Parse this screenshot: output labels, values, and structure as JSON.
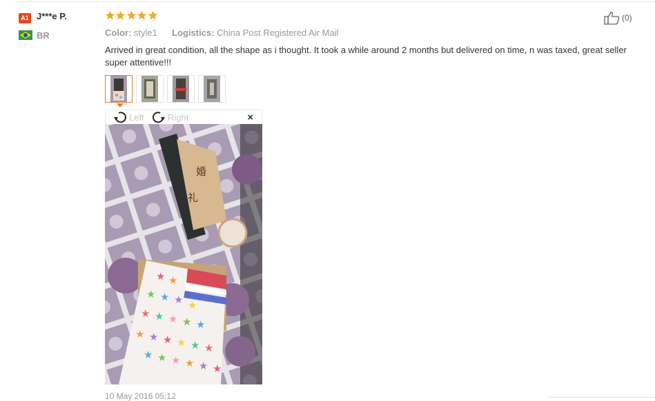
{
  "reviewer": {
    "level_badge": "A1",
    "name": "J***e P.",
    "country": "BR",
    "flag_icon": "brazil-flag-icon"
  },
  "rating": {
    "stars": 5,
    "max": 5,
    "star_color": "#f5a623"
  },
  "helpful": {
    "icon": "thumbs-up-icon",
    "count": "(0)"
  },
  "attributes": {
    "color_label": "Color:",
    "color_value": "style1",
    "logistics_label": "Logistics:",
    "logistics_value": "China Post Registered Air Mail"
  },
  "review_text": "Arrived in great condition, all the shape as i thought. It took a while around 2 months but delivered on time, n was taxed, great seller super attentive!!!",
  "thumbnails": {
    "count": 4,
    "selected_index": 0
  },
  "viewer": {
    "rotate_left_label": "Left",
    "rotate_right_label": "Right",
    "close_label": "×"
  },
  "date": "10 May 2016 05:12",
  "colors": {
    "badge": "#e4481b",
    "accent": "#e67e22",
    "muted_text": "#999999"
  }
}
